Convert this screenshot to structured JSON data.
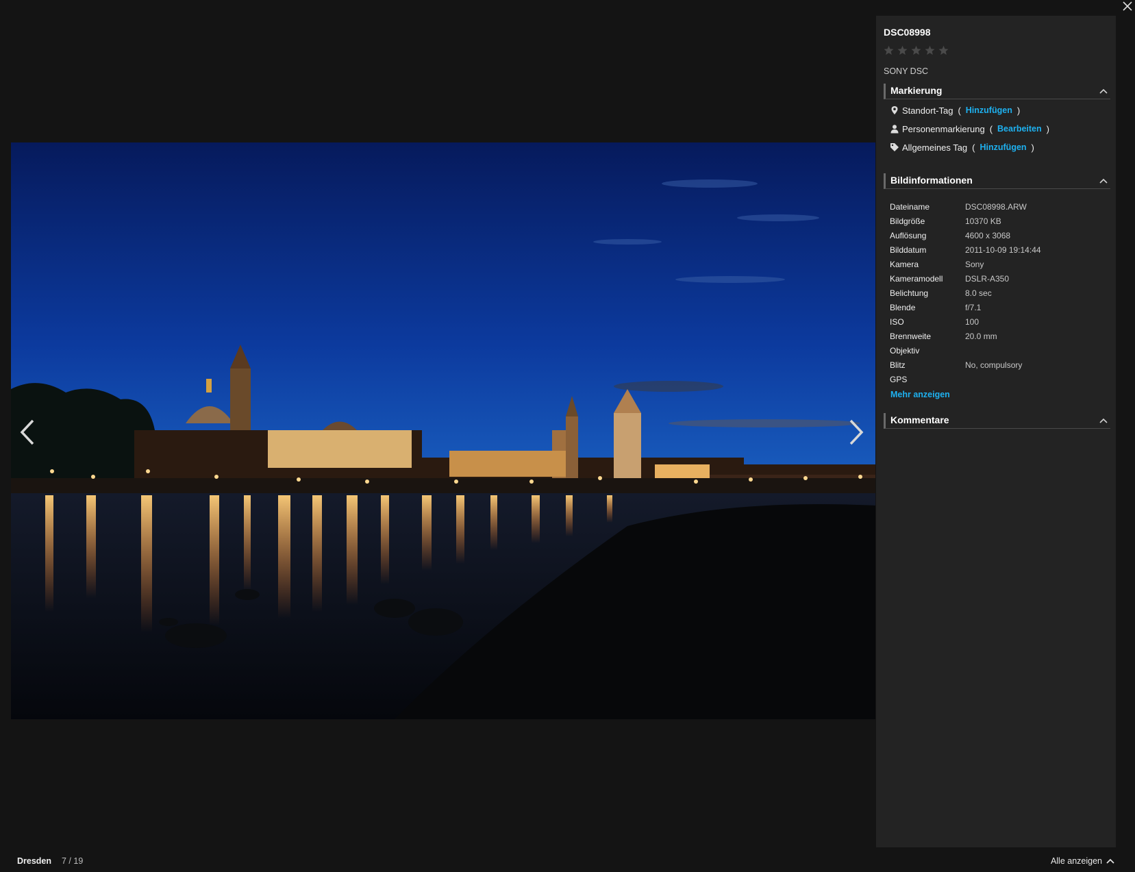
{
  "photo": {
    "title": "DSC08998",
    "rating": 0,
    "rating_max": 5,
    "description": "SONY DSC"
  },
  "tagging": {
    "heading": "Markierung",
    "items": [
      {
        "icon": "location-pin-icon",
        "label": "Standort-Tag",
        "action": "Hinzufügen"
      },
      {
        "icon": "person-icon",
        "label": "Personenmarkierung",
        "action": "Bearbeiten"
      },
      {
        "icon": "tag-icon",
        "label": "Allgemeines Tag",
        "action": "Hinzufügen"
      }
    ]
  },
  "info": {
    "heading": "Bildinformationen",
    "rows": [
      {
        "key": "Dateiname",
        "value": "DSC08998.ARW"
      },
      {
        "key": "Bildgröße",
        "value": "10370 KB"
      },
      {
        "key": "Auflösung",
        "value": "4600 x 3068"
      },
      {
        "key": "Bilddatum",
        "value": "2011-10-09 19:14:44"
      },
      {
        "key": "Kamera",
        "value": "Sony"
      },
      {
        "key": "Kameramodell",
        "value": "DSLR-A350"
      },
      {
        "key": "Belichtung",
        "value": "8.0 sec"
      },
      {
        "key": "Blende",
        "value": "f/7.1"
      },
      {
        "key": "ISO",
        "value": "100"
      },
      {
        "key": "Brennweite",
        "value": "20.0 mm"
      },
      {
        "key": "Objektiv",
        "value": ""
      },
      {
        "key": "Blitz",
        "value": "No, compulsory"
      },
      {
        "key": "GPS",
        "value": ""
      }
    ],
    "more_label": "Mehr anzeigen"
  },
  "comments": {
    "heading": "Kommentare"
  },
  "footer": {
    "album": "Dresden",
    "position": "7 / 19",
    "show_all": "Alle anzeigen"
  },
  "colors": {
    "background": "#141414",
    "panel": "#232323",
    "link": "#1eb1f0"
  }
}
